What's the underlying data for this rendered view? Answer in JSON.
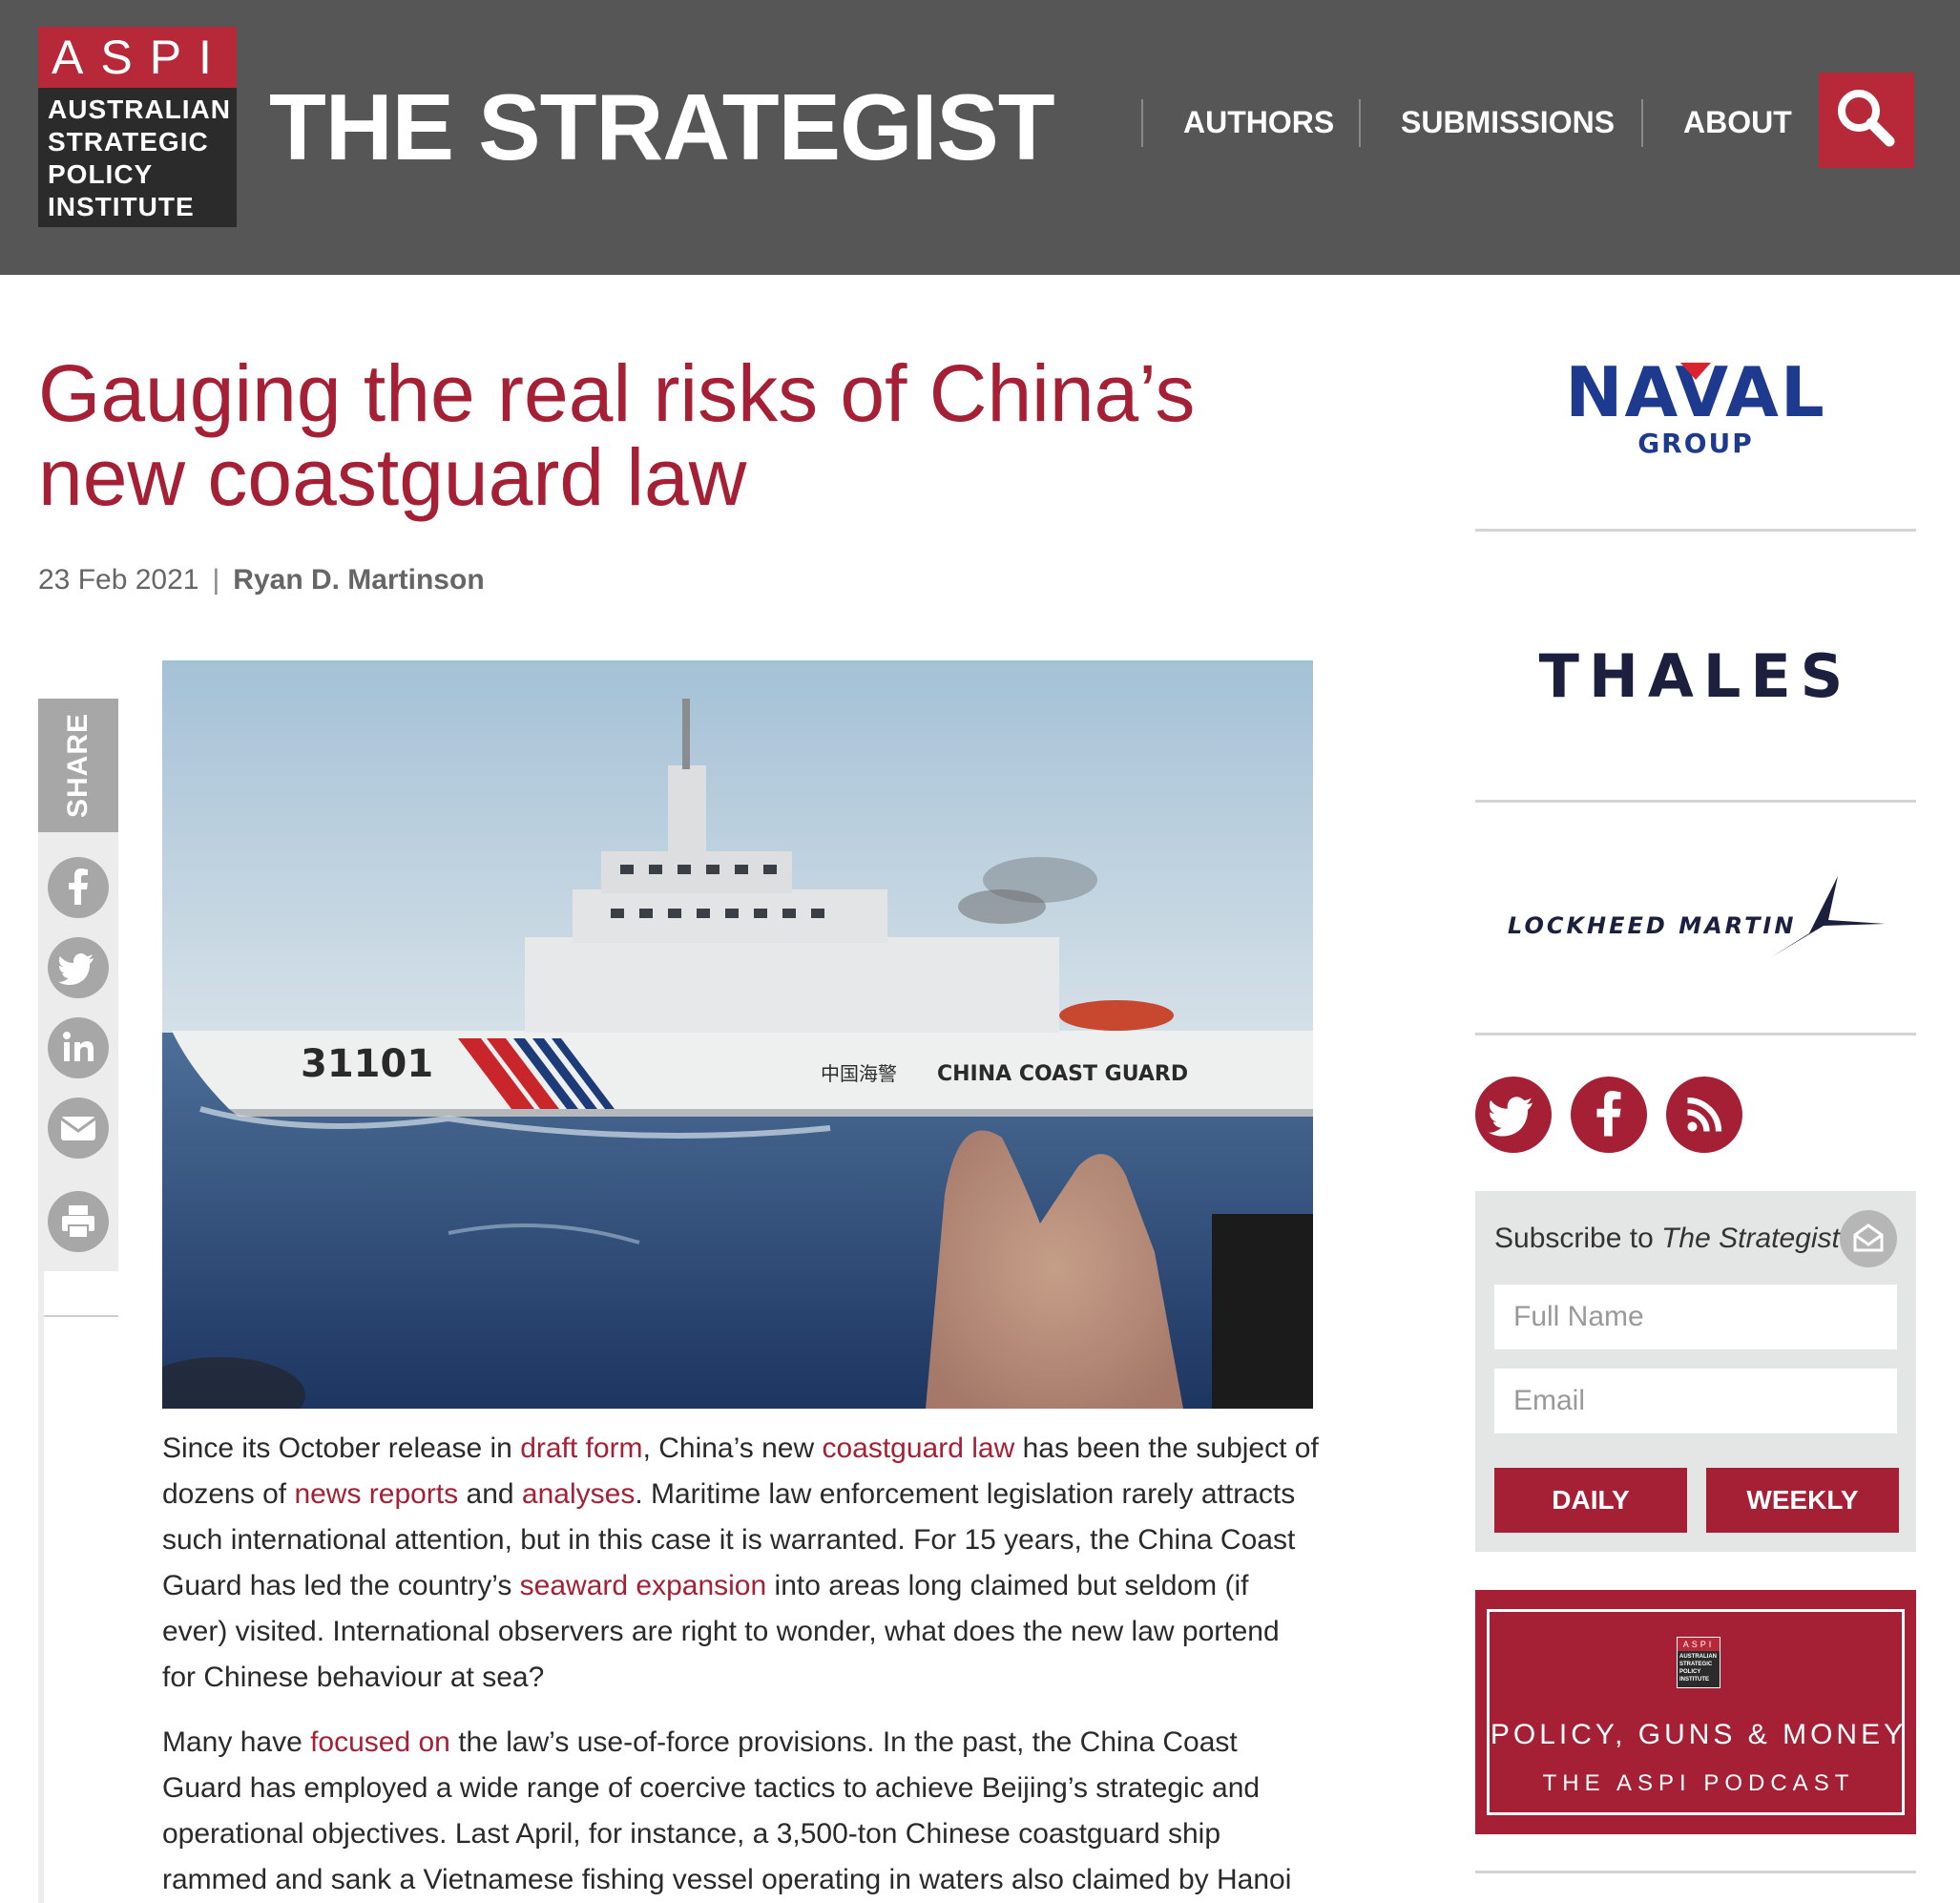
{
  "header": {
    "logo_top": "ASPI",
    "logo_lines": [
      "AUSTRALIAN",
      "STRATEGIC",
      "POLICY",
      "INSTITUTE"
    ],
    "site_title": "THE STRATEGIST",
    "nav": [
      "AUTHORS",
      "SUBMISSIONS",
      "ABOUT"
    ],
    "search_icon": "search-icon"
  },
  "article": {
    "headline": "Gauging the real risks of China’s new coastguard law",
    "date": "23 Feb 2021",
    "separator": "|",
    "author": "Ryan D. Martinson",
    "image": {
      "hull_number": "31101",
      "hull_chinese": "中国海警",
      "hull_text": "CHINA COAST GUARD"
    },
    "p1": {
      "t1": "Since its October release in ",
      "l1": "draft form",
      "t2": ", China’s new ",
      "l2": "coastguard law",
      "t3": " has been the subject of dozens of ",
      "l3": "news reports",
      "t4": " and ",
      "l4": "analyses",
      "t5": ". Maritime law enforcement legislation rarely attracts such international attention, but in this case it is warranted. For 15 years, the China Coast Guard has led the country’s ",
      "l5": "seaward expansion",
      "t6": " into areas long claimed but seldom (if ever) visited. International observers are right to wonder, what does the new law portend for Chinese behaviour at sea?"
    },
    "p2": {
      "t1": "Many have ",
      "l1": "focused on",
      "t2": " the law’s use-of-force provisions. In the past, the China Coast Guard has employed a wide range of coercive tactics to achieve Beijing’s strategic and operational objectives. Last April, for instance, a 3,500-ton Chinese coastguard ship rammed and sank a Vietnamese fishing vessel operating in waters also claimed by Hanoi"
    }
  },
  "share": {
    "label": "SHARE",
    "icons": [
      "facebook-icon",
      "twitter-icon",
      "linkedin-icon",
      "email-icon",
      "print-icon"
    ]
  },
  "sidebar": {
    "ads": {
      "naval_main": "NAVAL",
      "naval_sub": "GROUP",
      "thales": "THALES",
      "lockheed": "LOCKHEED MARTIN"
    },
    "social_icons": [
      "twitter-icon",
      "facebook-icon",
      "rss-icon"
    ],
    "subscribe": {
      "title_prefix": "Subscribe to ",
      "title_em": "The Strategist",
      "name_placeholder": "Full Name",
      "email_placeholder": "Email",
      "daily": "DAILY",
      "weekly": "WEEKLY"
    },
    "podcast": {
      "logo_top": "ASPI",
      "logo_text": "AUSTRALIAN STRATEGIC POLICY INSTITUTE",
      "title": "POLICY, GUNS & MONEY",
      "subtitle": "THE ASPI PODCAST"
    }
  },
  "colors": {
    "brand_red": "#a51f35",
    "header_gray": "#565656",
    "naval_blue": "#1d3a8f",
    "thales_navy": "#1c1f3d",
    "thales_teal": "#19b5b0"
  }
}
